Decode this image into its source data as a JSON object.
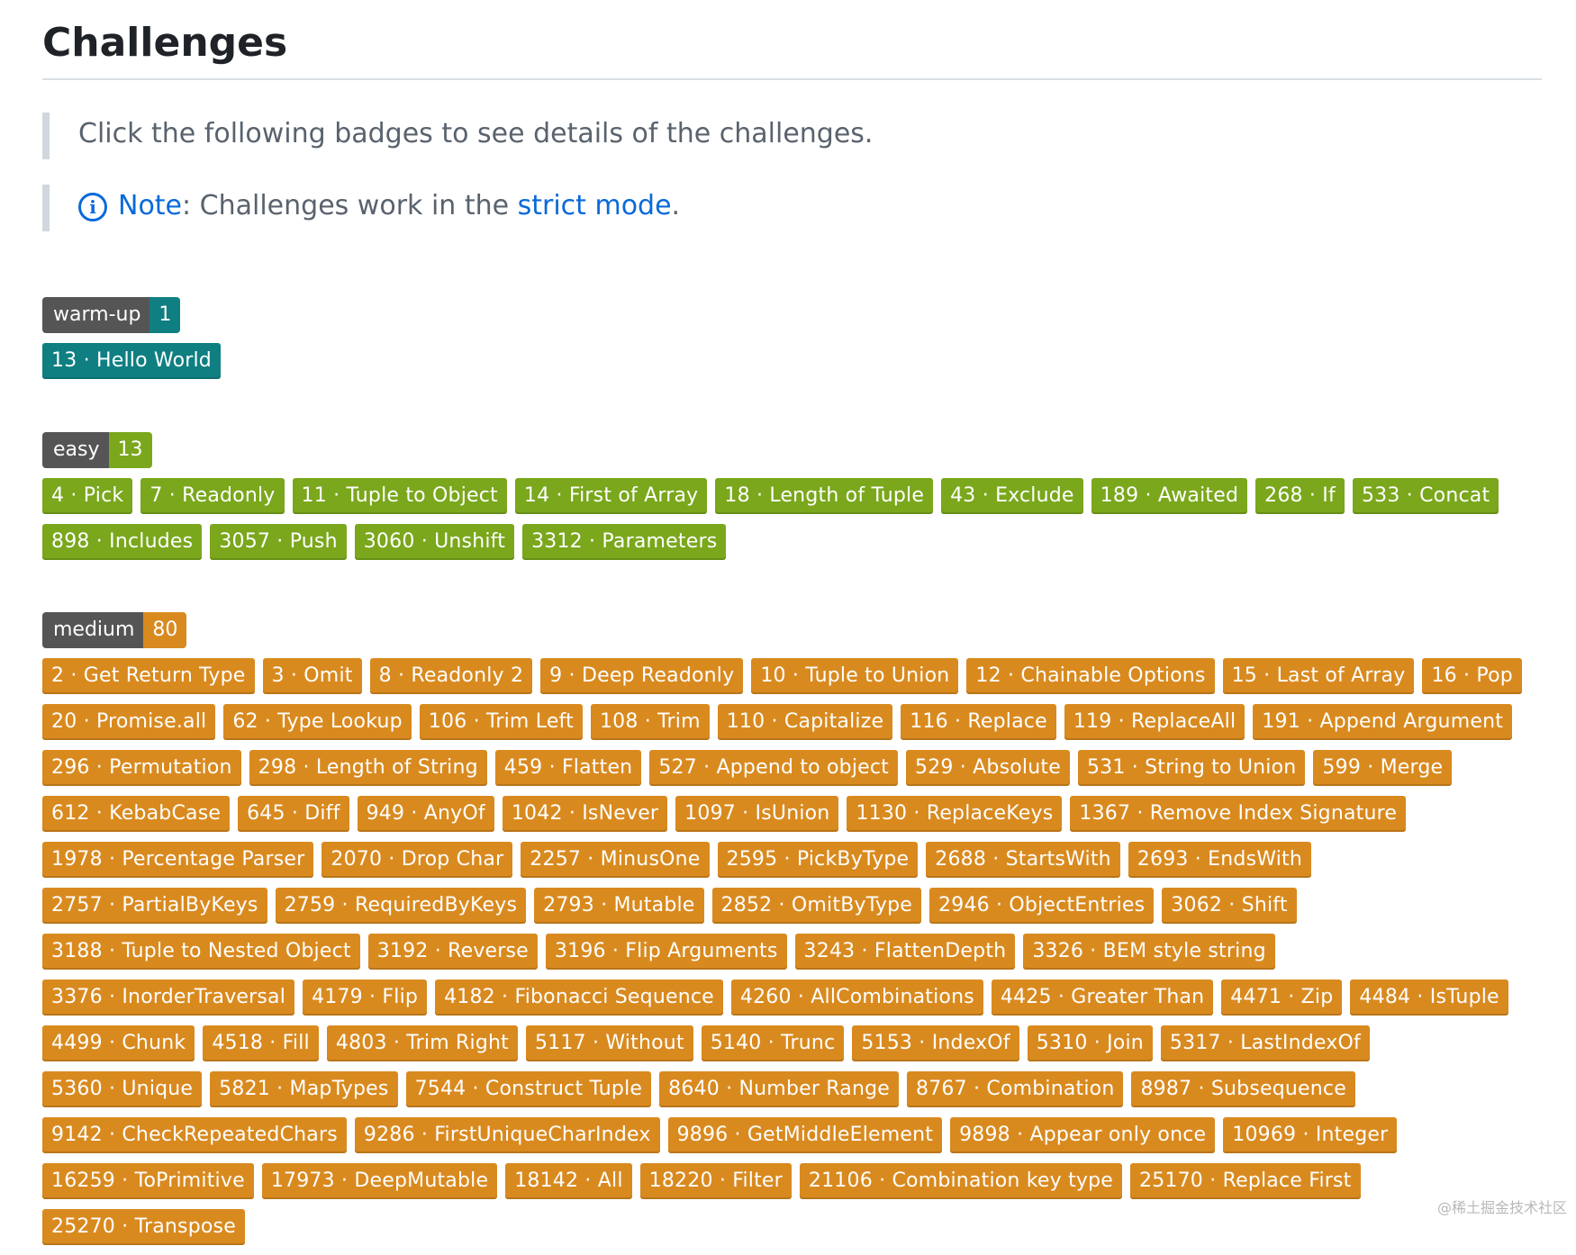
{
  "page": {
    "title": "Challenges",
    "intro": "Click the following badges to see details of the challenges.",
    "note_label": "Note",
    "note_text": ": Challenges work in the ",
    "note_link": "strict mode",
    "note_end": ".",
    "info_icon": "info-icon"
  },
  "colors": {
    "warm": "#0f7f82",
    "easy": "#7aa71c",
    "medium": "#d98a1f",
    "label": "#555555",
    "link": "#0969da"
  },
  "sections": [
    {
      "id": "warm",
      "label": "warm-up",
      "count": "1",
      "badges": [
        "13 · Hello World"
      ]
    },
    {
      "id": "easy",
      "label": "easy",
      "count": "13",
      "badges": [
        "4 · Pick",
        "7 · Readonly",
        "11 · Tuple to Object",
        "14 · First of Array",
        "18 · Length of Tuple",
        "43 · Exclude",
        "189 · Awaited",
        "268 · If",
        "533 · Concat",
        "898 · Includes",
        "3057 · Push",
        "3060 · Unshift",
        "3312 · Parameters"
      ]
    },
    {
      "id": "medium",
      "label": "medium",
      "count": "80",
      "badges": [
        "2 · Get Return Type",
        "3 · Omit",
        "8 · Readonly 2",
        "9 · Deep Readonly",
        "10 · Tuple to Union",
        "12 · Chainable Options",
        "15 · Last of Array",
        "16 · Pop",
        "20 · Promise.all",
        "62 · Type Lookup",
        "106 · Trim Left",
        "108 · Trim",
        "110 · Capitalize",
        "116 · Replace",
        "119 · ReplaceAll",
        "191 · Append Argument",
        "296 · Permutation",
        "298 · Length of String",
        "459 · Flatten",
        "527 · Append to object",
        "529 · Absolute",
        "531 · String to Union",
        "599 · Merge",
        "612 · KebabCase",
        "645 · Diff",
        "949 · AnyOf",
        "1042 · IsNever",
        "1097 · IsUnion",
        "1130 · ReplaceKeys",
        "1367 · Remove Index Signature",
        "1978 · Percentage Parser",
        "2070 · Drop Char",
        "2257 · MinusOne",
        "2595 · PickByType",
        "2688 · StartsWith",
        "2693 · EndsWith",
        "2757 · PartialByKeys",
        "2759 · RequiredByKeys",
        "2793 · Mutable",
        "2852 · OmitByType",
        "2946 · ObjectEntries",
        "3062 · Shift",
        "3188 · Tuple to Nested Object",
        "3192 · Reverse",
        "3196 · Flip Arguments",
        "3243 · FlattenDepth",
        "3326 · BEM style string",
        "3376 · InorderTraversal",
        "4179 · Flip",
        "4182 · Fibonacci Sequence",
        "4260 · AllCombinations",
        "4425 · Greater Than",
        "4471 · Zip",
        "4484 · IsTuple",
        "4499 · Chunk",
        "4518 · Fill",
        "4803 · Trim Right",
        "5117 · Without",
        "5140 · Trunc",
        "5153 · IndexOf",
        "5310 · Join",
        "5317 · LastIndexOf",
        "5360 · Unique",
        "5821 · MapTypes",
        "7544 · Construct Tuple",
        "8640 · Number Range",
        "8767 · Combination",
        "8987 · Subsequence",
        "9142 · CheckRepeatedChars",
        "9286 · FirstUniqueCharIndex",
        "9896 · GetMiddleElement",
        "9898 · Appear only once",
        "10969 · Integer",
        "16259 · ToPrimitive",
        "17973 · DeepMutable",
        "18142 · All",
        "18220 · Filter",
        "21106 · Combination key type",
        "25170 · Replace First",
        "25270 · Transpose"
      ]
    }
  ],
  "watermark": "@稀土掘金技术社区"
}
